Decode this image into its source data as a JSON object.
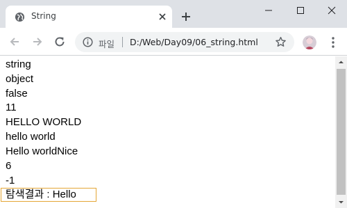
{
  "browser": {
    "tab": {
      "title": "String"
    },
    "address_bar": {
      "scheme_label": "파일",
      "url": "D:/Web/Day09/06_string.html"
    }
  },
  "page": {
    "output_lines": [
      "string",
      "object",
      "false",
      "11",
      "HELLO WORLD",
      "hello world",
      "Hello worldNice",
      "6",
      "-1"
    ],
    "search_result": "탐색결과 : Hello"
  },
  "colors": {
    "tabstrip_bg": "#dee1e6",
    "omnibox_bg": "#f1f3f4",
    "result_border": "#e4a635",
    "scroll_thumb": "#c1c1c1"
  }
}
